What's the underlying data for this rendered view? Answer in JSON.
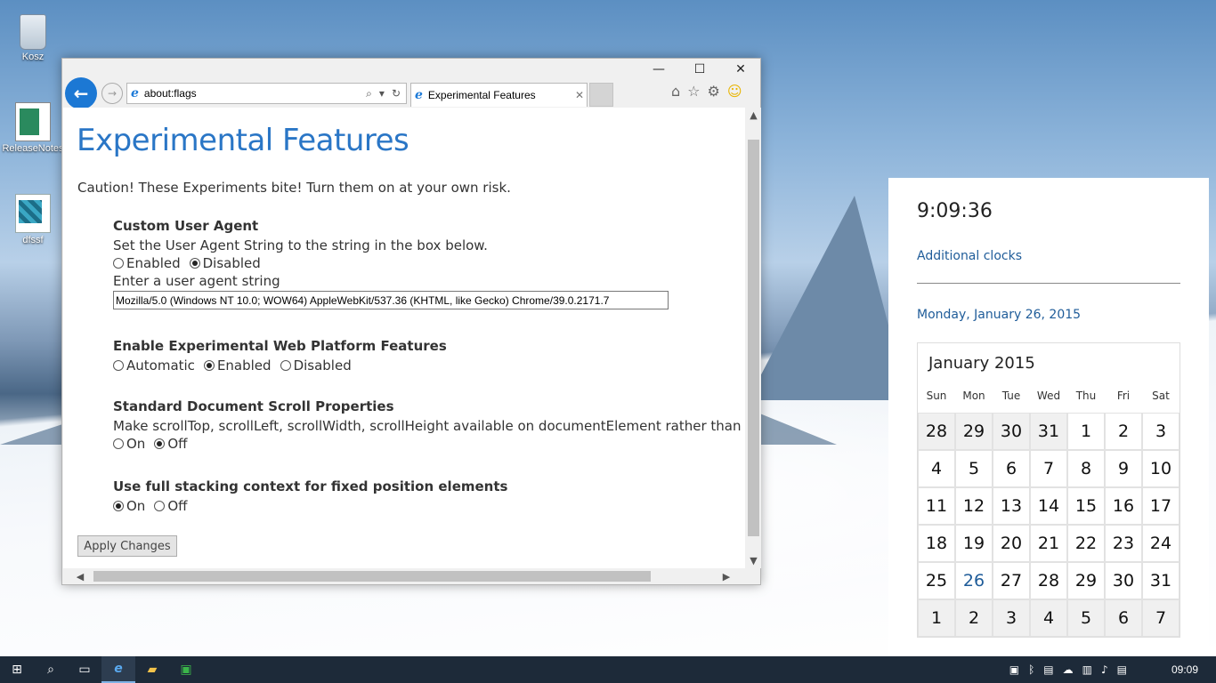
{
  "desktop": {
    "icons": [
      {
        "label": "Kosz"
      },
      {
        "label": "ReleaseNotes"
      },
      {
        "label": "dfssf"
      }
    ]
  },
  "browser": {
    "window_controls": {
      "minimize": "—",
      "maximize": "☐",
      "close": "✕"
    },
    "address": "about:flags",
    "tab_title": "Experimental Features",
    "tab_close": "✕",
    "page": {
      "title": "Experimental Features",
      "caution": "Caution! These Experiments bite! Turn them on at your own risk.",
      "sections": [
        {
          "heading": "Custom User Agent",
          "description": "Set the User Agent String to the string in the box below.",
          "options": [
            {
              "label": "Enabled",
              "selected": false
            },
            {
              "label": "Disabled",
              "selected": true
            }
          ],
          "input_label": "Enter a user agent string",
          "input_value": "Mozilla/5.0 (Windows NT 10.0; WOW64) AppleWebKit/537.36 (KHTML, like Gecko) Chrome/39.0.2171.7"
        },
        {
          "heading": "Enable Experimental Web Platform Features",
          "options": [
            {
              "label": "Automatic",
              "selected": false
            },
            {
              "label": "Enabled",
              "selected": true
            },
            {
              "label": "Disabled",
              "selected": false
            }
          ]
        },
        {
          "heading": "Standard Document Scroll Properties",
          "description": "Make scrollTop, scrollLeft, scrollWidth, scrollHeight available on documentElement rather than body e",
          "options": [
            {
              "label": "On",
              "selected": false
            },
            {
              "label": "Off",
              "selected": true
            }
          ]
        },
        {
          "heading": "Use full stacking context for fixed position elements",
          "options": [
            {
              "label": "On",
              "selected": true
            },
            {
              "label": "Off",
              "selected": false
            }
          ]
        }
      ],
      "apply_button": "Apply Changes"
    }
  },
  "clock": {
    "time": "9:09:36",
    "additional_clocks": "Additional clocks",
    "date": "Monday, January 26, 2015",
    "calendar": {
      "month": "January 2015",
      "weekdays": [
        "Sun",
        "Mon",
        "Tue",
        "Wed",
        "Thu",
        "Fri",
        "Sat"
      ],
      "days": [
        {
          "d": "28",
          "m": true
        },
        {
          "d": "29",
          "m": true
        },
        {
          "d": "30",
          "m": true
        },
        {
          "d": "31",
          "m": true
        },
        {
          "d": "1"
        },
        {
          "d": "2"
        },
        {
          "d": "3"
        },
        {
          "d": "4"
        },
        {
          "d": "5"
        },
        {
          "d": "6"
        },
        {
          "d": "7"
        },
        {
          "d": "8"
        },
        {
          "d": "9"
        },
        {
          "d": "10"
        },
        {
          "d": "11"
        },
        {
          "d": "12"
        },
        {
          "d": "13"
        },
        {
          "d": "14"
        },
        {
          "d": "15"
        },
        {
          "d": "16"
        },
        {
          "d": "17"
        },
        {
          "d": "18"
        },
        {
          "d": "19"
        },
        {
          "d": "20"
        },
        {
          "d": "21"
        },
        {
          "d": "22"
        },
        {
          "d": "23"
        },
        {
          "d": "24"
        },
        {
          "d": "25"
        },
        {
          "d": "26",
          "t": true
        },
        {
          "d": "27"
        },
        {
          "d": "28"
        },
        {
          "d": "29"
        },
        {
          "d": "30"
        },
        {
          "d": "31"
        },
        {
          "d": "1",
          "m": true
        },
        {
          "d": "2",
          "m": true
        },
        {
          "d": "3",
          "m": true
        },
        {
          "d": "4",
          "m": true
        },
        {
          "d": "5",
          "m": true
        },
        {
          "d": "6",
          "m": true
        },
        {
          "d": "7",
          "m": true
        }
      ]
    }
  },
  "taskbar": {
    "clock": "09:09"
  },
  "colors": {
    "accent": "#1c78d4",
    "title_blue": "#2a76c6",
    "taskbar": "#1d2a39"
  }
}
